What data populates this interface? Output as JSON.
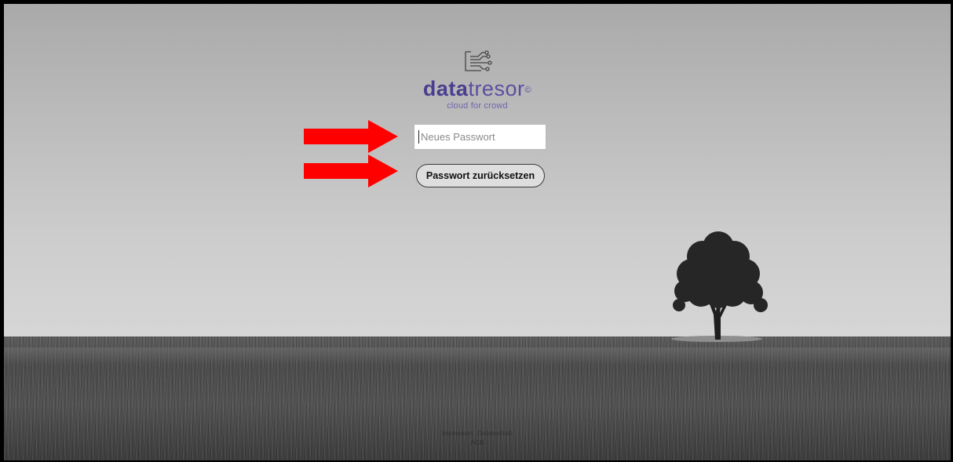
{
  "brand": {
    "name_bold": "data",
    "name_light": "tresor",
    "registered": "©",
    "tagline": "cloud for crowd",
    "color": "#4a3f8f",
    "icon": "datatresor-circuit-logo-icon"
  },
  "form": {
    "password_placeholder": "Neues Passwort",
    "password_value": "",
    "reset_button_label": "Passwort zurücksetzen"
  },
  "annotations": {
    "arrow_color": "#ff0000",
    "arrow_icon": "right-arrow-icon",
    "count": 2
  },
  "background": {
    "description_icon": "landscape-tree-photo"
  },
  "footer": {
    "line1": [
      "Impressum",
      "Datenschutz"
    ],
    "line2": [
      "AGB"
    ]
  }
}
